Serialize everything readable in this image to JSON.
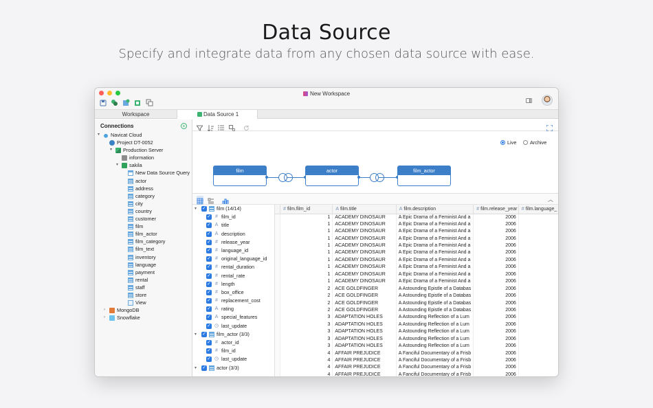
{
  "hero": {
    "title": "Data Source",
    "subtitle": "Specify and integrate data from any chosen data source with ease."
  },
  "window": {
    "title": "New Workspace"
  },
  "tabs": [
    {
      "label": "Workspace"
    },
    {
      "label": "Data Source 1"
    }
  ],
  "sidebar": {
    "header": "Connections",
    "tree": [
      {
        "label": "Navicat Cloud",
        "level": 0,
        "icon": "cloud-icon",
        "arrow": "▾"
      },
      {
        "label": "Project DT-0052",
        "level": 1,
        "icon": "project-icon",
        "arrow": ""
      },
      {
        "label": "Production Server",
        "level": 2,
        "icon": "server-icon",
        "arrow": "▾"
      },
      {
        "label": "information",
        "level": 3,
        "icon": "database-icon",
        "arrow": ""
      },
      {
        "label": "sakila",
        "level": 3,
        "icon": "database-icon",
        "arrow": "▾"
      },
      {
        "label": "New Data Source Query",
        "level": 4,
        "icon": "query-icon",
        "arrow": ""
      },
      {
        "label": "actor",
        "level": 4,
        "icon": "table-icon",
        "arrow": ""
      },
      {
        "label": "address",
        "level": 4,
        "icon": "table-icon",
        "arrow": ""
      },
      {
        "label": "category",
        "level": 4,
        "icon": "table-icon",
        "arrow": ""
      },
      {
        "label": "city",
        "level": 4,
        "icon": "table-icon",
        "arrow": ""
      },
      {
        "label": "country",
        "level": 4,
        "icon": "table-icon",
        "arrow": ""
      },
      {
        "label": "customer",
        "level": 4,
        "icon": "table-icon",
        "arrow": ""
      },
      {
        "label": "film",
        "level": 4,
        "icon": "table-icon",
        "arrow": ""
      },
      {
        "label": "film_actor",
        "level": 4,
        "icon": "table-icon",
        "arrow": ""
      },
      {
        "label": "film_category",
        "level": 4,
        "icon": "table-icon",
        "arrow": ""
      },
      {
        "label": "film_text",
        "level": 4,
        "icon": "table-icon",
        "arrow": ""
      },
      {
        "label": "inventory",
        "level": 4,
        "icon": "table-icon",
        "arrow": ""
      },
      {
        "label": "language",
        "level": 4,
        "icon": "table-icon",
        "arrow": ""
      },
      {
        "label": "payment",
        "level": 4,
        "icon": "table-icon",
        "arrow": ""
      },
      {
        "label": "rental",
        "level": 4,
        "icon": "table-icon",
        "arrow": ""
      },
      {
        "label": "staff",
        "level": 4,
        "icon": "table-icon",
        "arrow": ""
      },
      {
        "label": "store",
        "level": 4,
        "icon": "table-icon",
        "arrow": ""
      },
      {
        "label": "View",
        "level": 4,
        "icon": "view-icon",
        "arrow": ""
      },
      {
        "label": "MongoDB",
        "level": 1,
        "icon": "mongodb-icon",
        "arrow": "›"
      },
      {
        "label": "Snowflake",
        "level": 1,
        "icon": "snowflake-icon",
        "arrow": "›"
      }
    ]
  },
  "canvas": {
    "mode_live": "Live",
    "mode_archive": "Archive",
    "nodes": [
      {
        "label": "film"
      },
      {
        "label": "actor"
      },
      {
        "label": "film_actor"
      }
    ]
  },
  "fields": [
    {
      "type": "group",
      "label": "film (14/14)"
    },
    {
      "type": "field",
      "label": "film_id",
      "icon": "#"
    },
    {
      "type": "field",
      "label": "title",
      "icon": "A"
    },
    {
      "type": "field",
      "label": "description",
      "icon": "A"
    },
    {
      "type": "field",
      "label": "release_year",
      "icon": "#"
    },
    {
      "type": "field",
      "label": "language_id",
      "icon": "#"
    },
    {
      "type": "field",
      "label": "original_language_id",
      "icon": "#"
    },
    {
      "type": "field",
      "label": "rental_duration",
      "icon": "#"
    },
    {
      "type": "field",
      "label": "rental_rate",
      "icon": "#"
    },
    {
      "type": "field",
      "label": "length",
      "icon": "#"
    },
    {
      "type": "field",
      "label": "box_office",
      "icon": "#"
    },
    {
      "type": "field",
      "label": "replacement_cost",
      "icon": "#"
    },
    {
      "type": "field",
      "label": "rating",
      "icon": "A"
    },
    {
      "type": "field",
      "label": "special_features",
      "icon": "A"
    },
    {
      "type": "field",
      "label": "last_update",
      "icon": "◷"
    },
    {
      "type": "group",
      "label": "film_actor (3/3)"
    },
    {
      "type": "field",
      "label": "actor_id",
      "icon": "#"
    },
    {
      "type": "field",
      "label": "film_id",
      "icon": "#"
    },
    {
      "type": "field",
      "label": "last_update",
      "icon": "◷"
    },
    {
      "type": "group",
      "label": "actor (3/3)"
    }
  ],
  "grid": {
    "columns": [
      {
        "label": "film.film_id",
        "icon": "#"
      },
      {
        "label": "film.title",
        "icon": "A"
      },
      {
        "label": "film.description",
        "icon": "A"
      },
      {
        "label": "film.release_year",
        "icon": "#"
      },
      {
        "label": "film.language_",
        "icon": "#"
      }
    ],
    "rows": [
      [
        "1",
        "ACADEMY DINOSAUR",
        "A Epic Drama of a Feminist And a",
        "2006",
        ""
      ],
      [
        "1",
        "ACADEMY DINOSAUR",
        "A Epic Drama of a Feminist And a",
        "2006",
        ""
      ],
      [
        "1",
        "ACADEMY DINOSAUR",
        "A Epic Drama of a Feminist And a",
        "2006",
        ""
      ],
      [
        "1",
        "ACADEMY DINOSAUR",
        "A Epic Drama of a Feminist And a",
        "2006",
        ""
      ],
      [
        "1",
        "ACADEMY DINOSAUR",
        "A Epic Drama of a Feminist And a",
        "2006",
        ""
      ],
      [
        "1",
        "ACADEMY DINOSAUR",
        "A Epic Drama of a Feminist And a",
        "2006",
        ""
      ],
      [
        "1",
        "ACADEMY DINOSAUR",
        "A Epic Drama of a Feminist And a",
        "2006",
        ""
      ],
      [
        "1",
        "ACADEMY DINOSAUR",
        "A Epic Drama of a Feminist And a",
        "2006",
        ""
      ],
      [
        "1",
        "ACADEMY DINOSAUR",
        "A Epic Drama of a Feminist And a",
        "2006",
        ""
      ],
      [
        "1",
        "ACADEMY DINOSAUR",
        "A Epic Drama of a Feminist And a",
        "2006",
        ""
      ],
      [
        "2",
        "ACE GOLDFINGER",
        "A Astounding Epistle of a Databas",
        "2006",
        ""
      ],
      [
        "2",
        "ACE GOLDFINGER",
        "A Astounding Epistle of a Databas",
        "2006",
        ""
      ],
      [
        "2",
        "ACE GOLDFINGER",
        "A Astounding Epistle of a Databas",
        "2006",
        ""
      ],
      [
        "2",
        "ACE GOLDFINGER",
        "A Astounding Epistle of a Databas",
        "2006",
        ""
      ],
      [
        "3",
        "ADAPTATION HOLES",
        "A Astounding Reflection of a Lum",
        "2006",
        ""
      ],
      [
        "3",
        "ADAPTATION HOLES",
        "A Astounding Reflection of a Lum",
        "2006",
        ""
      ],
      [
        "3",
        "ADAPTATION HOLES",
        "A Astounding Reflection of a Lum",
        "2006",
        ""
      ],
      [
        "3",
        "ADAPTATION HOLES",
        "A Astounding Reflection of a Lum",
        "2006",
        ""
      ],
      [
        "3",
        "ADAPTATION HOLES",
        "A Astounding Reflection of a Lum",
        "2006",
        ""
      ],
      [
        "4",
        "AFFAIR PREJUDICE",
        "A Fanciful Documentary of a Frisb",
        "2006",
        ""
      ],
      [
        "4",
        "AFFAIR PREJUDICE",
        "A Fanciful Documentary of a Frisb",
        "2006",
        ""
      ],
      [
        "4",
        "AFFAIR PREJUDICE",
        "A Fanciful Documentary of a Frisb",
        "2006",
        ""
      ],
      [
        "4",
        "AFFAIR PREJUDICE",
        "A Fanciful Documentary of a Frisb",
        "2006",
        ""
      ]
    ]
  },
  "colors": {
    "accent": "#2a7ae2",
    "node": "#3d7ec9",
    "brand_green": "#3cb371"
  }
}
